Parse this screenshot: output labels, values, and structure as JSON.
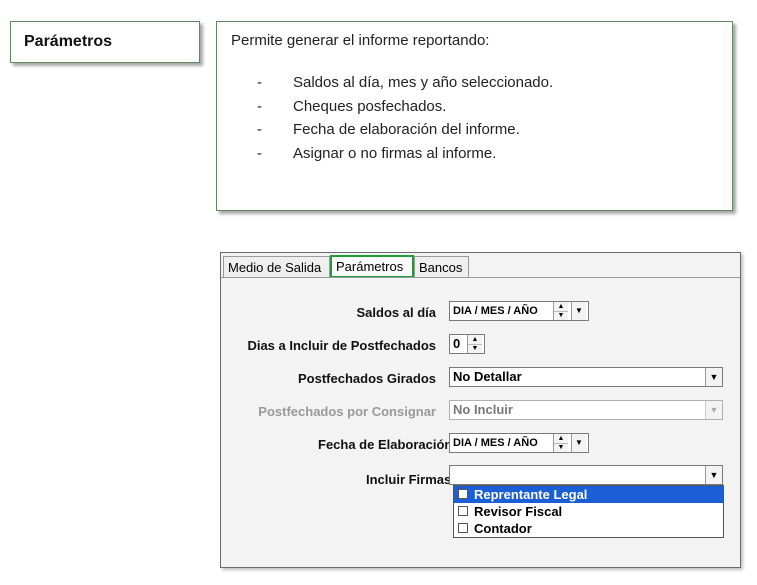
{
  "section_label": "Parámetros",
  "description": {
    "intro": "Permite generar el informe reportando:",
    "items": [
      "Saldos al día, mes y año seleccionado.",
      "Cheques posfechados.",
      "Fecha de elaboración del informe.",
      "Asignar o no firmas al informe."
    ],
    "bullet": "-"
  },
  "tabs": [
    "Medio de Salida",
    "Parámetros",
    "Bancos"
  ],
  "active_tab": "Parámetros",
  "fields": {
    "saldos_label": "Saldos al día",
    "saldos_value": "DIA / MES / AÑO",
    "dias_label": "Dias a Incluir de Postfechados",
    "dias_value": "0",
    "girados_label": "Postfechados Girados",
    "girados_value": "No Detallar",
    "consignar_label": "Postfechados por Consignar",
    "consignar_value": "No Incluir",
    "fecha_label": "Fecha de Elaboración",
    "fecha_value": "DIA / MES / AÑO",
    "firmas_label": "Incluir Firmas",
    "firmas_value": ""
  },
  "firmas_options": [
    {
      "label": "Reprentante Legal",
      "checked": false,
      "highlighted": true
    },
    {
      "label": "Revisor Fiscal",
      "checked": false,
      "highlighted": false
    },
    {
      "label": "Contador",
      "checked": false,
      "highlighted": false
    }
  ],
  "colors": {
    "active_tab_border": "#1e9c3a",
    "selection": "#1b5fd6",
    "box_border": "#5e8a5e"
  }
}
